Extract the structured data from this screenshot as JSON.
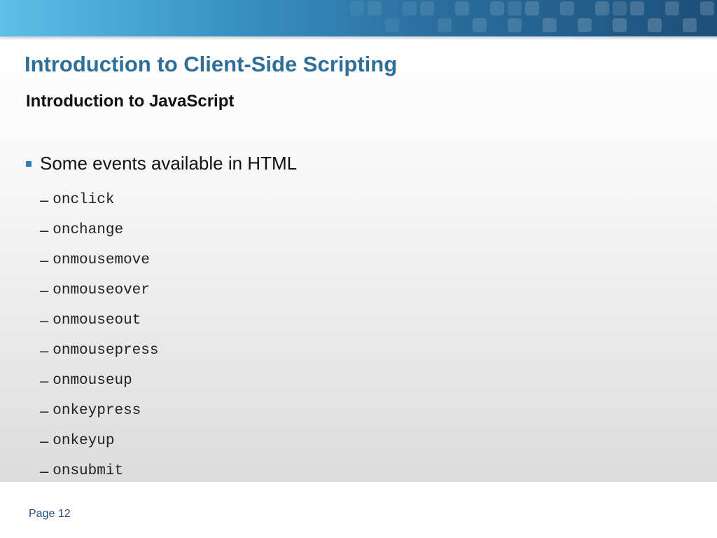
{
  "slide": {
    "title": "Introduction to Client-Side Scripting",
    "subtitle": "Introduction to JavaScript",
    "bullet": "Some events available in HTML",
    "dash": "–",
    "events": [
      "onclick",
      "onchange",
      "onmousemove",
      "onmouseover",
      "onmouseout",
      "onmousepress",
      "onmouseup",
      "onkeypress",
      "onkeyup",
      "onsubmit"
    ],
    "page_label": "Page 12"
  },
  "colors": {
    "title": "#2e6f9a",
    "bullet_marker": "#2f7eb2",
    "page_label": "#1f4f8a"
  },
  "icons": {
    "bullet": "square-bullet-icon"
  }
}
